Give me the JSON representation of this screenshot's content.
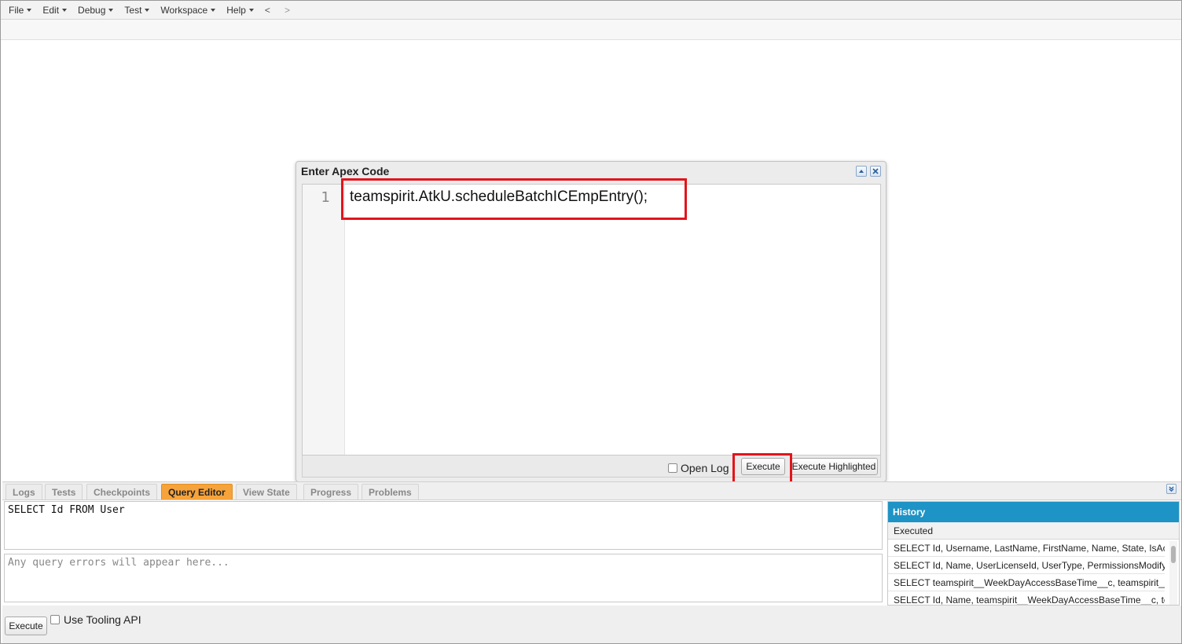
{
  "menu": {
    "items": [
      "File",
      "Edit",
      "Debug",
      "Test",
      "Workspace",
      "Help"
    ],
    "back": "<",
    "forward": ">"
  },
  "dialog": {
    "title": "Enter Apex Code",
    "line_number": "1",
    "code": "teamspirit.AtkU.scheduleBatchICEmpEntry();",
    "open_log_label": "Open Log",
    "execute_label": "Execute",
    "execute_highlighted_label": "Execute Highlighted",
    "highlight_color": "#e3141b"
  },
  "tabs": [
    {
      "label": "Logs",
      "active": false
    },
    {
      "label": "Tests",
      "active": false
    },
    {
      "label": "Checkpoints",
      "active": false
    },
    {
      "label": "Query Editor",
      "active": true
    },
    {
      "label": "View State",
      "active": false
    },
    {
      "label": "Progress",
      "active": false
    },
    {
      "label": "Problems",
      "active": false
    }
  ],
  "query_editor": {
    "query": "SELECT Id FROM User",
    "errors_placeholder": "Any query errors will appear here...",
    "execute_label": "Execute",
    "tooling_label": "Use Tooling API"
  },
  "history": {
    "title": "History",
    "column": "Executed",
    "rows": [
      "SELECT Id, Username, LastName, FirstName, Name, State, IsActi...",
      "SELECT Id, Name, UserLicenseId, UserType, PermissionsModifyAl...",
      "SELECT teamspirit__WeekDayAccessBaseTime__c, teamspirit__H...",
      "SELECT Id, Name, teamspirit__WeekDayAccessBaseTime__c, tea..."
    ],
    "accent_color": "#1e93c6"
  }
}
